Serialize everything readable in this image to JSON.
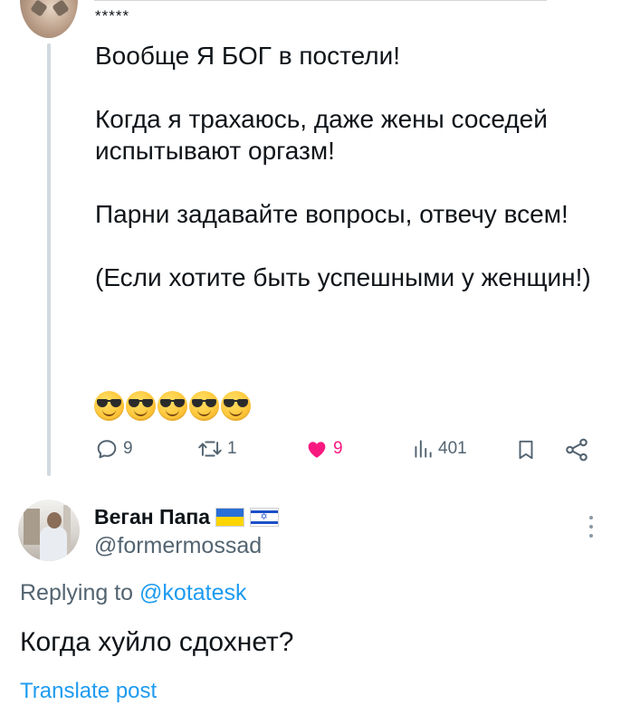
{
  "parent_tweet": {
    "header_text": "*****",
    "paragraphs": [
      "Вообще Я БОГ в постели!",
      "Когда я трахаюсь, даже жены соседей испытывают оргазм!",
      "Парни задавайте вопросы, отвечу всем!",
      "(Если хотите быть успешными у женщин!)"
    ],
    "emoji": [
      "smiling-face-with-sunglasses",
      "smiling-face-with-sunglasses",
      "smiling-face-with-sunglasses",
      "smiling-face-with-sunglasses",
      "smiling-face-with-sunglasses"
    ],
    "actions": {
      "reply_count": "9",
      "repost_count": "1",
      "like_count": "9",
      "views_count": "401"
    },
    "colors": {
      "like": "#f91880",
      "muted": "#536471",
      "thread_line": "#cfd9de"
    }
  },
  "reply_tweet": {
    "display_name": "Веган Папа",
    "flags": [
      "ukraine-flag",
      "israel-flag"
    ],
    "handle": "@formermossad",
    "replying_prefix": "Replying to",
    "replying_mention": "@kotatesk",
    "text": "Когда хуйло сдохнет?",
    "translate_label": "Translate post",
    "colors": {
      "link": "#1d9bf0"
    }
  }
}
